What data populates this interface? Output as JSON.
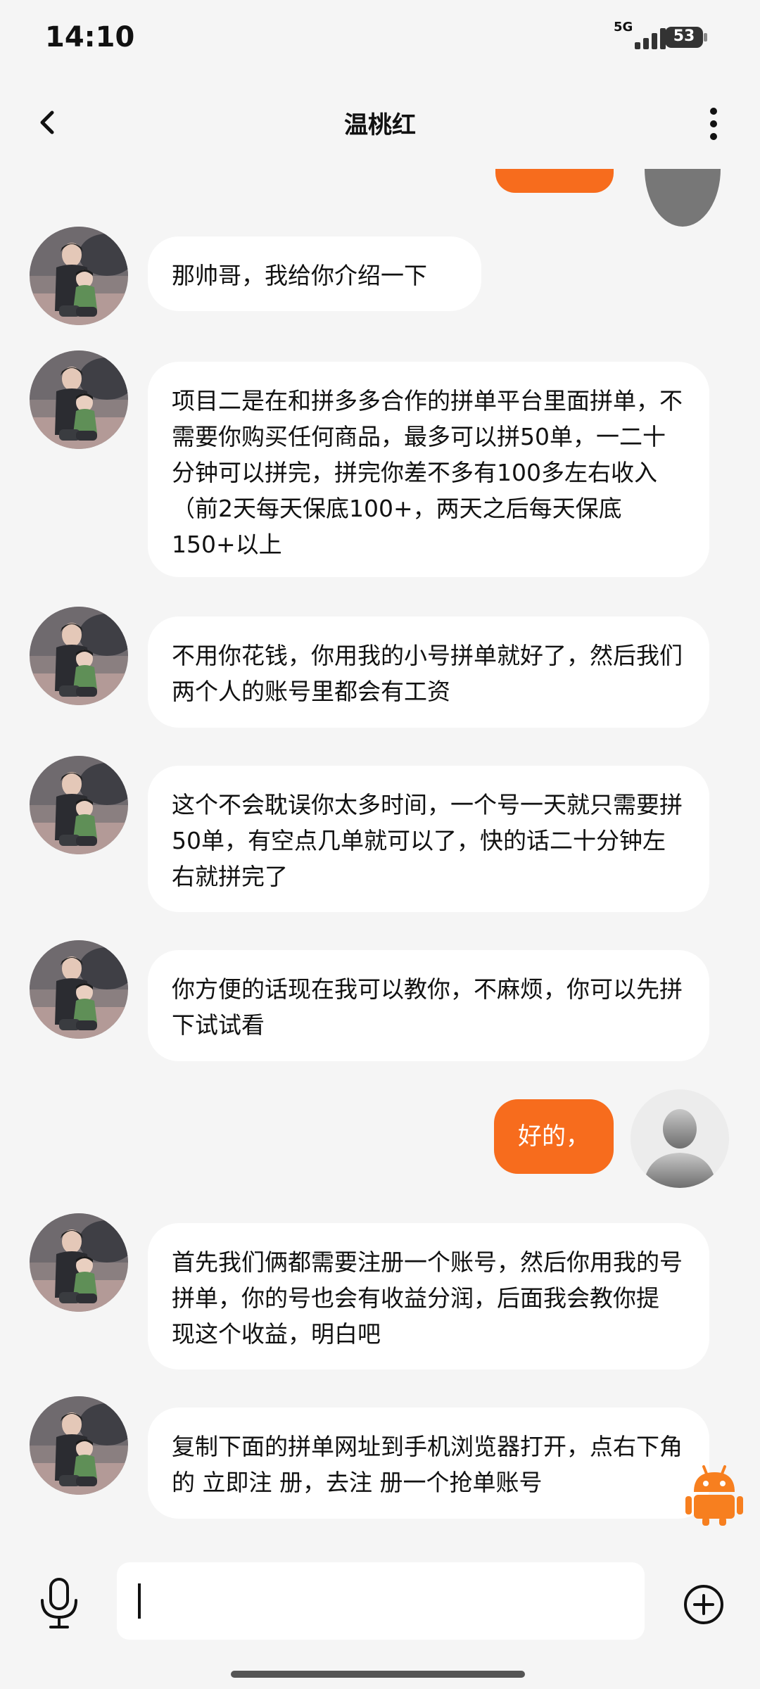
{
  "status_bar": {
    "time": "14:10",
    "network": "5G",
    "battery": "53"
  },
  "header": {
    "title": "温桃红"
  },
  "messages": [
    {
      "from": "contact",
      "text": "那帅哥，我给你介绍一下"
    },
    {
      "from": "contact",
      "text": "项目二是在和拼多多合作的拼单平台里面拼单，不需要你购买任何商品，最多可以拼50单，一二十分钟可以拼完，拼完你差不多有100多左右收入（前2天每天保底100+，两天之后每天保底150+以上"
    },
    {
      "from": "contact",
      "text": "不用你花钱，你用我的小号拼单就好了，然后我们两个人的账号里都会有工资"
    },
    {
      "from": "contact",
      "text": "这个不会耽误你太多时间，一个号一天就只需要拼50单，有空点几单就可以了，快的话二十分钟左右就拼完了"
    },
    {
      "from": "contact",
      "text": "你方便的话现在我可以教你，不麻烦，你可以先拼下试试看"
    },
    {
      "from": "me",
      "text": "好的，"
    },
    {
      "from": "contact",
      "text": "首先我们俩都需要注册一个账号，然后你用我的号拼单，你的号也会有收益分润，后面我会教你提 现这个收益，明白吧"
    },
    {
      "from": "contact",
      "text": "复制下面的拼单网址到手机浏览器打开，点右下角的 立即注 册，去注 册一个抢单账号"
    }
  ],
  "input": {
    "placeholder": ""
  },
  "icons": {
    "back": "chevron-left-icon",
    "more": "more-vertical-icon",
    "mic": "microphone-icon",
    "plus": "plus-circle-icon",
    "bot": "android-robot-icon"
  },
  "colors": {
    "accent": "#f76c1d",
    "background": "#f5f5f5",
    "bubble": "#ffffff"
  }
}
